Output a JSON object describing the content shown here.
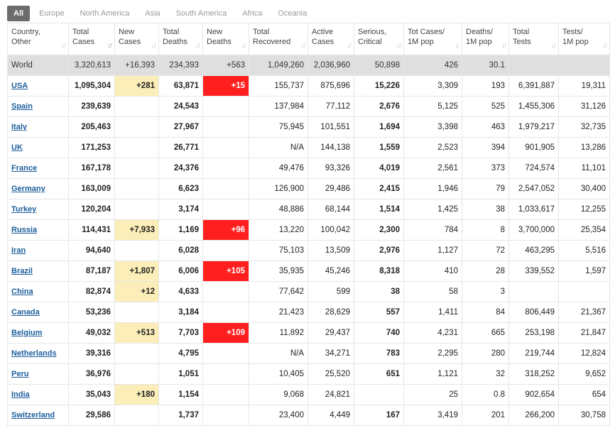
{
  "tabs": [
    "All",
    "Europe",
    "North America",
    "Asia",
    "South America",
    "Africa",
    "Oceania"
  ],
  "active_tab": "All",
  "columns": [
    {
      "line1": "Country,",
      "line2": "Other"
    },
    {
      "line1": "Total",
      "line2": "Cases"
    },
    {
      "line1": "New",
      "line2": "Cases"
    },
    {
      "line1": "Total",
      "line2": "Deaths"
    },
    {
      "line1": "New",
      "line2": "Deaths"
    },
    {
      "line1": "Total",
      "line2": "Recovered"
    },
    {
      "line1": "Active",
      "line2": "Cases"
    },
    {
      "line1": "Serious,",
      "line2": "Critical"
    },
    {
      "line1": "Tot Cases/",
      "line2": "1M pop"
    },
    {
      "line1": "Deaths/",
      "line2": "1M pop"
    },
    {
      "line1": "Total",
      "line2": "Tests"
    },
    {
      "line1": "Tests/",
      "line2": "1M pop"
    }
  ],
  "world": [
    "World",
    "3,320,613",
    "+16,393",
    "234,393",
    "+563",
    "1,049,260",
    "2,036,960",
    "50,898",
    "426",
    "30.1",
    "",
    ""
  ],
  "rows": [
    [
      "USA",
      "1,095,304",
      "+281",
      "63,871",
      "+15",
      "155,737",
      "875,696",
      "15,226",
      "3,309",
      "193",
      "6,391,887",
      "19,311"
    ],
    [
      "Spain",
      "239,639",
      "",
      "24,543",
      "",
      "137,984",
      "77,112",
      "2,676",
      "5,125",
      "525",
      "1,455,306",
      "31,126"
    ],
    [
      "Italy",
      "205,463",
      "",
      "27,967",
      "",
      "75,945",
      "101,551",
      "1,694",
      "3,398",
      "463",
      "1,979,217",
      "32,735"
    ],
    [
      "UK",
      "171,253",
      "",
      "26,771",
      "",
      "N/A",
      "144,138",
      "1,559",
      "2,523",
      "394",
      "901,905",
      "13,286"
    ],
    [
      "France",
      "167,178",
      "",
      "24,376",
      "",
      "49,476",
      "93,326",
      "4,019",
      "2,561",
      "373",
      "724,574",
      "11,101"
    ],
    [
      "Germany",
      "163,009",
      "",
      "6,623",
      "",
      "126,900",
      "29,486",
      "2,415",
      "1,946",
      "79",
      "2,547,052",
      "30,400"
    ],
    [
      "Turkey",
      "120,204",
      "",
      "3,174",
      "",
      "48,886",
      "68,144",
      "1,514",
      "1,425",
      "38",
      "1,033,617",
      "12,255"
    ],
    [
      "Russia",
      "114,431",
      "+7,933",
      "1,169",
      "+96",
      "13,220",
      "100,042",
      "2,300",
      "784",
      "8",
      "3,700,000",
      "25,354"
    ],
    [
      "Iran",
      "94,640",
      "",
      "6,028",
      "",
      "75,103",
      "13,509",
      "2,976",
      "1,127",
      "72",
      "463,295",
      "5,516"
    ],
    [
      "Brazil",
      "87,187",
      "+1,807",
      "6,006",
      "+105",
      "35,935",
      "45,246",
      "8,318",
      "410",
      "28",
      "339,552",
      "1,597"
    ],
    [
      "China",
      "82,874",
      "+12",
      "4,633",
      "",
      "77,642",
      "599",
      "38",
      "58",
      "3",
      "",
      ""
    ],
    [
      "Canada",
      "53,236",
      "",
      "3,184",
      "",
      "21,423",
      "28,629",
      "557",
      "1,411",
      "84",
      "806,449",
      "21,367"
    ],
    [
      "Belgium",
      "49,032",
      "+513",
      "7,703",
      "+109",
      "11,892",
      "29,437",
      "740",
      "4,231",
      "665",
      "253,198",
      "21,847"
    ],
    [
      "Netherlands",
      "39,316",
      "",
      "4,795",
      "",
      "N/A",
      "34,271",
      "783",
      "2,295",
      "280",
      "219,744",
      "12,824"
    ],
    [
      "Peru",
      "36,976",
      "",
      "1,051",
      "",
      "10,405",
      "25,520",
      "651",
      "1,121",
      "32",
      "318,252",
      "9,652"
    ],
    [
      "India",
      "35,043",
      "+180",
      "1,154",
      "",
      "9,068",
      "24,821",
      "",
      "25",
      "0.8",
      "902,654",
      "654"
    ],
    [
      "Switzerland",
      "29,586",
      "",
      "1,737",
      "",
      "23,400",
      "4,449",
      "167",
      "3,419",
      "201",
      "266,200",
      "30,758"
    ]
  ],
  "sort_icon": "sort-arrows-icon",
  "colors": {
    "tab_active_bg": "#6c6c6c",
    "world_row_bg": "#dfdfdf",
    "new_cases_highlight": "#fbeeb8",
    "new_deaths_highlight": "#ff1f1f",
    "link_color": "#1b5e9b"
  }
}
